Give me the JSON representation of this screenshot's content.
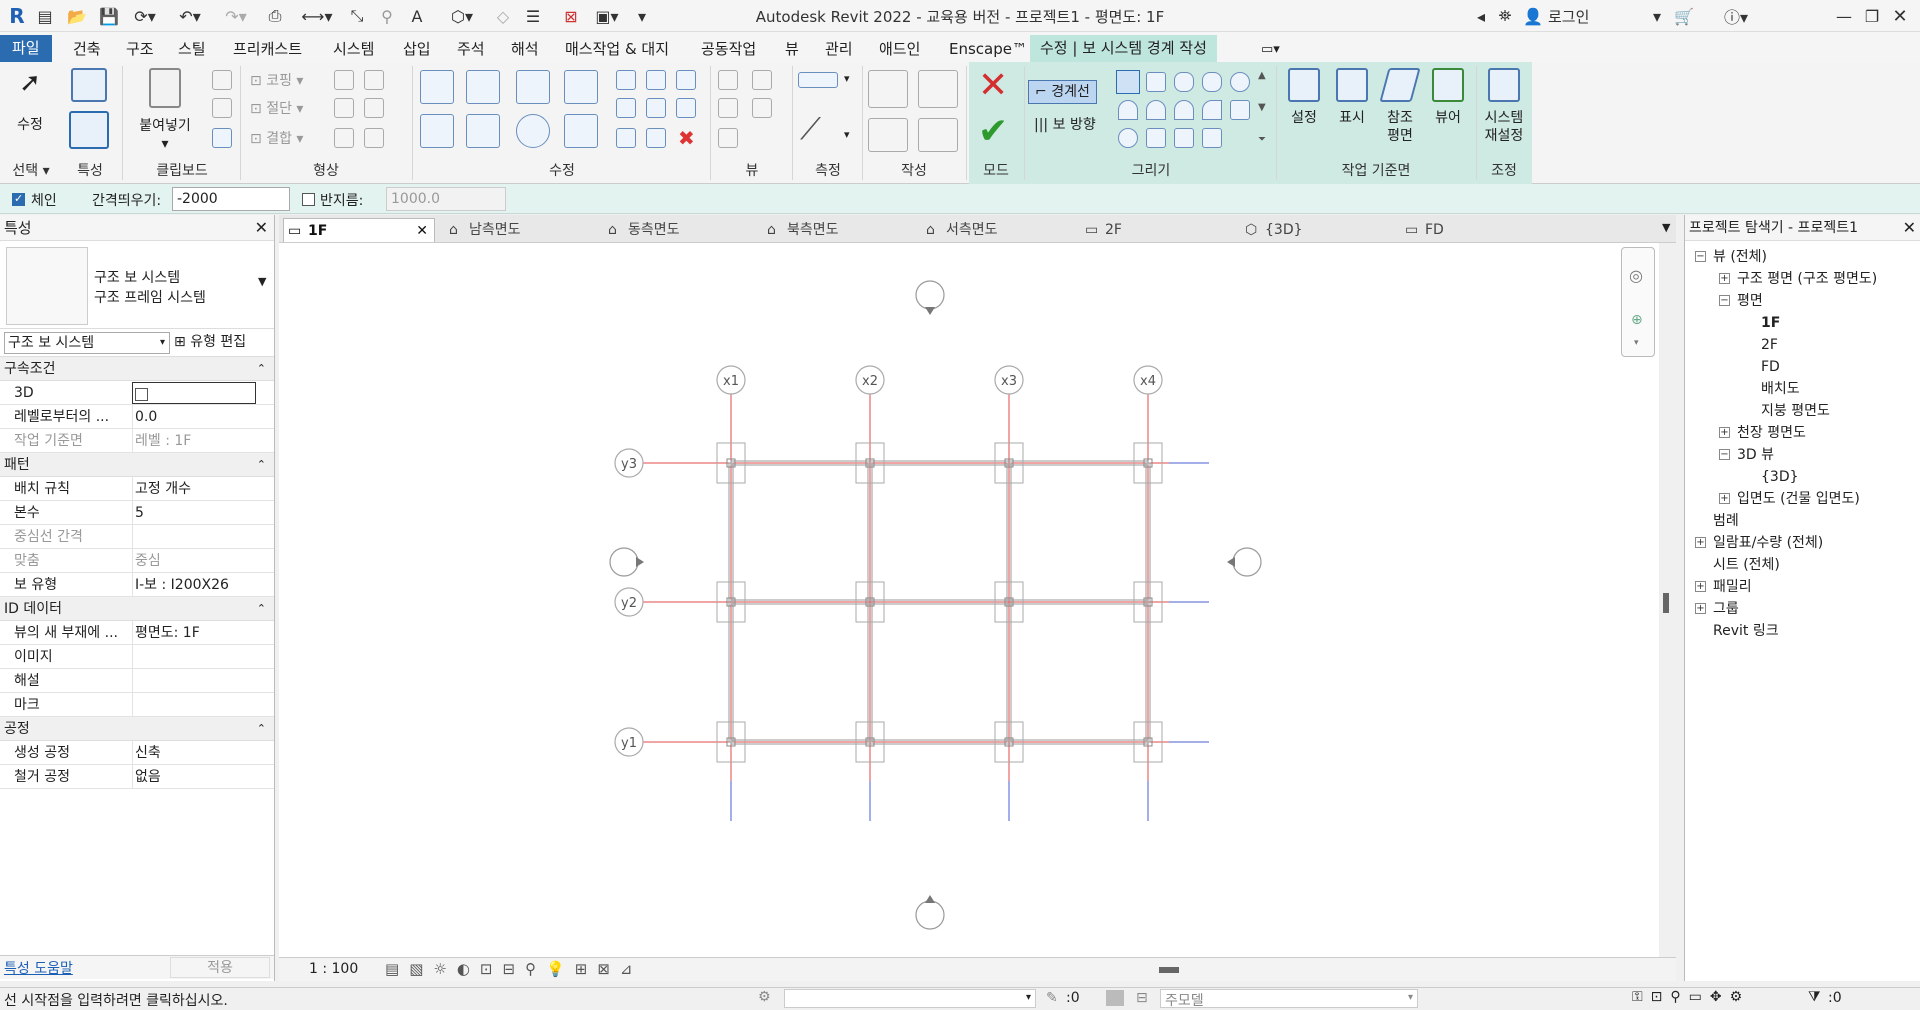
{
  "titlebar": {
    "title": "Autodesk Revit 2022 - 교육용 버전 - 프로젝트1 - 평면도: 1F",
    "login": "로그인",
    "app_letter": "R"
  },
  "menu_tabs": [
    "파일",
    "건축",
    "구조",
    "스틸",
    "프리캐스트",
    "시스템",
    "삽입",
    "주석",
    "해석",
    "매스작업 & 대지",
    "공동작업",
    "뷰",
    "관리",
    "애드인",
    "Enscape™",
    "수정 | 보 시스템 경계 작성"
  ],
  "ribbon": {
    "select_modify": "수정",
    "select_label": "선택",
    "properties_label": "특성",
    "paste": "붙여넣기",
    "clipboard_label": "클립보드",
    "copy": "코핑",
    "cut": "절단",
    "join": "결합",
    "geometry_label": "형상",
    "modify_label": "수정",
    "view_label": "뷰",
    "measure_label": "측정",
    "create_label": "작성",
    "mode_label": "모드",
    "boundary_line": "경계선",
    "beam_direction": "보 방향",
    "draw_label": "그리기",
    "wp_set": "설정",
    "wp_show": "표시",
    "wp_ref_plane_1": "참조",
    "wp_ref_plane_2": "평면",
    "wp_viewer": "뷰어",
    "workplane_label": "작업 기준면",
    "reset_system_1": "시스템",
    "reset_system_2": "재설정",
    "adjust_label": "조정"
  },
  "optionsbar": {
    "chain_label": "체인",
    "chain_checked": true,
    "offset_label": "간격띄우기:",
    "offset_value": "-2000",
    "radius_label": "반지름:",
    "radius_value": "1000.0"
  },
  "properties": {
    "header": "특성",
    "type_line1": "구조 보 시스템",
    "type_line2": "구조 프레임 시스템",
    "selector": "구조 보 시스템",
    "edit_type": "유형 편집",
    "groups": [
      {
        "name": "구속조건",
        "rows": [
          {
            "key": "3D",
            "value": "",
            "checkbox": true
          },
          {
            "key": "레벨로부터의 ...",
            "value": "0.0"
          },
          {
            "key": "작업 기준면",
            "value": "레벨 : 1F",
            "dim": true
          }
        ]
      },
      {
        "name": "패턴",
        "rows": [
          {
            "key": "배치 규칙",
            "value": "고정 개수"
          },
          {
            "key": "본수",
            "value": "5"
          },
          {
            "key": "중심선 간격",
            "value": "",
            "dim": true
          },
          {
            "key": "맞춤",
            "value": "중심",
            "dim": true
          },
          {
            "key": "보 유형",
            "value": "I-보 : I200X26"
          }
        ]
      },
      {
        "name": "ID 데이터",
        "rows": [
          {
            "key": "뷰의 새 부재에 ...",
            "value": "평면도: 1F"
          },
          {
            "key": "이미지",
            "value": ""
          },
          {
            "key": "해설",
            "value": ""
          },
          {
            "key": "마크",
            "value": ""
          }
        ]
      },
      {
        "name": "공정",
        "rows": [
          {
            "key": "생성 공정",
            "value": "신축"
          },
          {
            "key": "철거 공정",
            "value": "없음"
          }
        ]
      }
    ],
    "help_link": "특성 도움말",
    "apply": "적용"
  },
  "view_tabs": [
    {
      "label": "1F",
      "active": true
    },
    {
      "label": "남측면도"
    },
    {
      "label": "동측면도"
    },
    {
      "label": "북측면도"
    },
    {
      "label": "서측면도"
    },
    {
      "label": "2F"
    },
    {
      "label": "{3D}"
    },
    {
      "label": "FD"
    }
  ],
  "grid": {
    "x_labels": [
      "x1",
      "x2",
      "x3",
      "x4"
    ],
    "y_labels": [
      "y3",
      "y2",
      "y1"
    ]
  },
  "view_control": {
    "scale": "1 : 100"
  },
  "browser": {
    "header": "프로젝트 탐색기 - 프로젝트1",
    "nodes": [
      {
        "label": "뷰 (전체)",
        "level": 0,
        "exp": "-"
      },
      {
        "label": "구조 평면 (구조 평면도)",
        "level": 1,
        "exp": "+"
      },
      {
        "label": "평면",
        "level": 1,
        "exp": "-"
      },
      {
        "label": "1F",
        "level": 2,
        "bold": true
      },
      {
        "label": "2F",
        "level": 2
      },
      {
        "label": "FD",
        "level": 2
      },
      {
        "label": "배치도",
        "level": 2
      },
      {
        "label": "지붕 평면도",
        "level": 2
      },
      {
        "label": "천장 평면도",
        "level": 1,
        "exp": "+"
      },
      {
        "label": "3D 뷰",
        "level": 1,
        "exp": "-"
      },
      {
        "label": "{3D}",
        "level": 2
      },
      {
        "label": "입면도 (건물 입면도)",
        "level": 1,
        "exp": "+"
      },
      {
        "label": "범례",
        "level": 0
      },
      {
        "label": "일람표/수량 (전체)",
        "level": 0,
        "exp": "+"
      },
      {
        "label": "시트 (전체)",
        "level": 0
      },
      {
        "label": "패밀리",
        "level": 0,
        "exp": "+"
      },
      {
        "label": "그룹",
        "level": 0,
        "exp": "+"
      },
      {
        "label": "Revit 링크",
        "level": 0
      }
    ]
  },
  "status": {
    "message": "선 시작점을 입력하려면 클릭하십시오.",
    "coord": ":0",
    "model": "주모델",
    "filter": ":0"
  },
  "colors": {
    "accent": "#2b6cb0",
    "context_tab": "#bfe6dd",
    "grid_red": "#e04848",
    "grid_blue": "#4a5fd6"
  }
}
